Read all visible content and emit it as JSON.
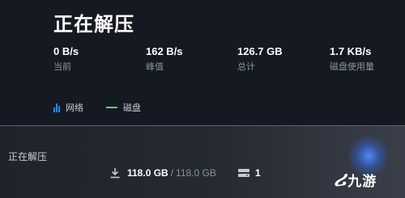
{
  "header": {
    "title": "正在解压"
  },
  "stats": [
    {
      "value": "0 B/s",
      "label": "当前"
    },
    {
      "value": "162 B/s",
      "label": "峰值"
    },
    {
      "value": "126.7 GB",
      "label": "总计"
    },
    {
      "value": "1.7 KB/s",
      "label": "磁盘使用量"
    }
  ],
  "legend": {
    "network": "网络",
    "disk": "磁盘"
  },
  "colors": {
    "network": "#2a86e8",
    "disk": "#5fd35c",
    "divider": "#2f6fb8",
    "background": "#151a22"
  },
  "bottom": {
    "title": "正在解压",
    "downloaded": "118.0 GB",
    "separator": "/",
    "total": "118.0 GB",
    "disk_partial": "1"
  },
  "watermark": {
    "mark": "ሪ",
    "text": "九游"
  },
  "icons": {
    "download": "download-icon",
    "disk": "hard-drive-icon",
    "network": "bar-chart-icon"
  }
}
